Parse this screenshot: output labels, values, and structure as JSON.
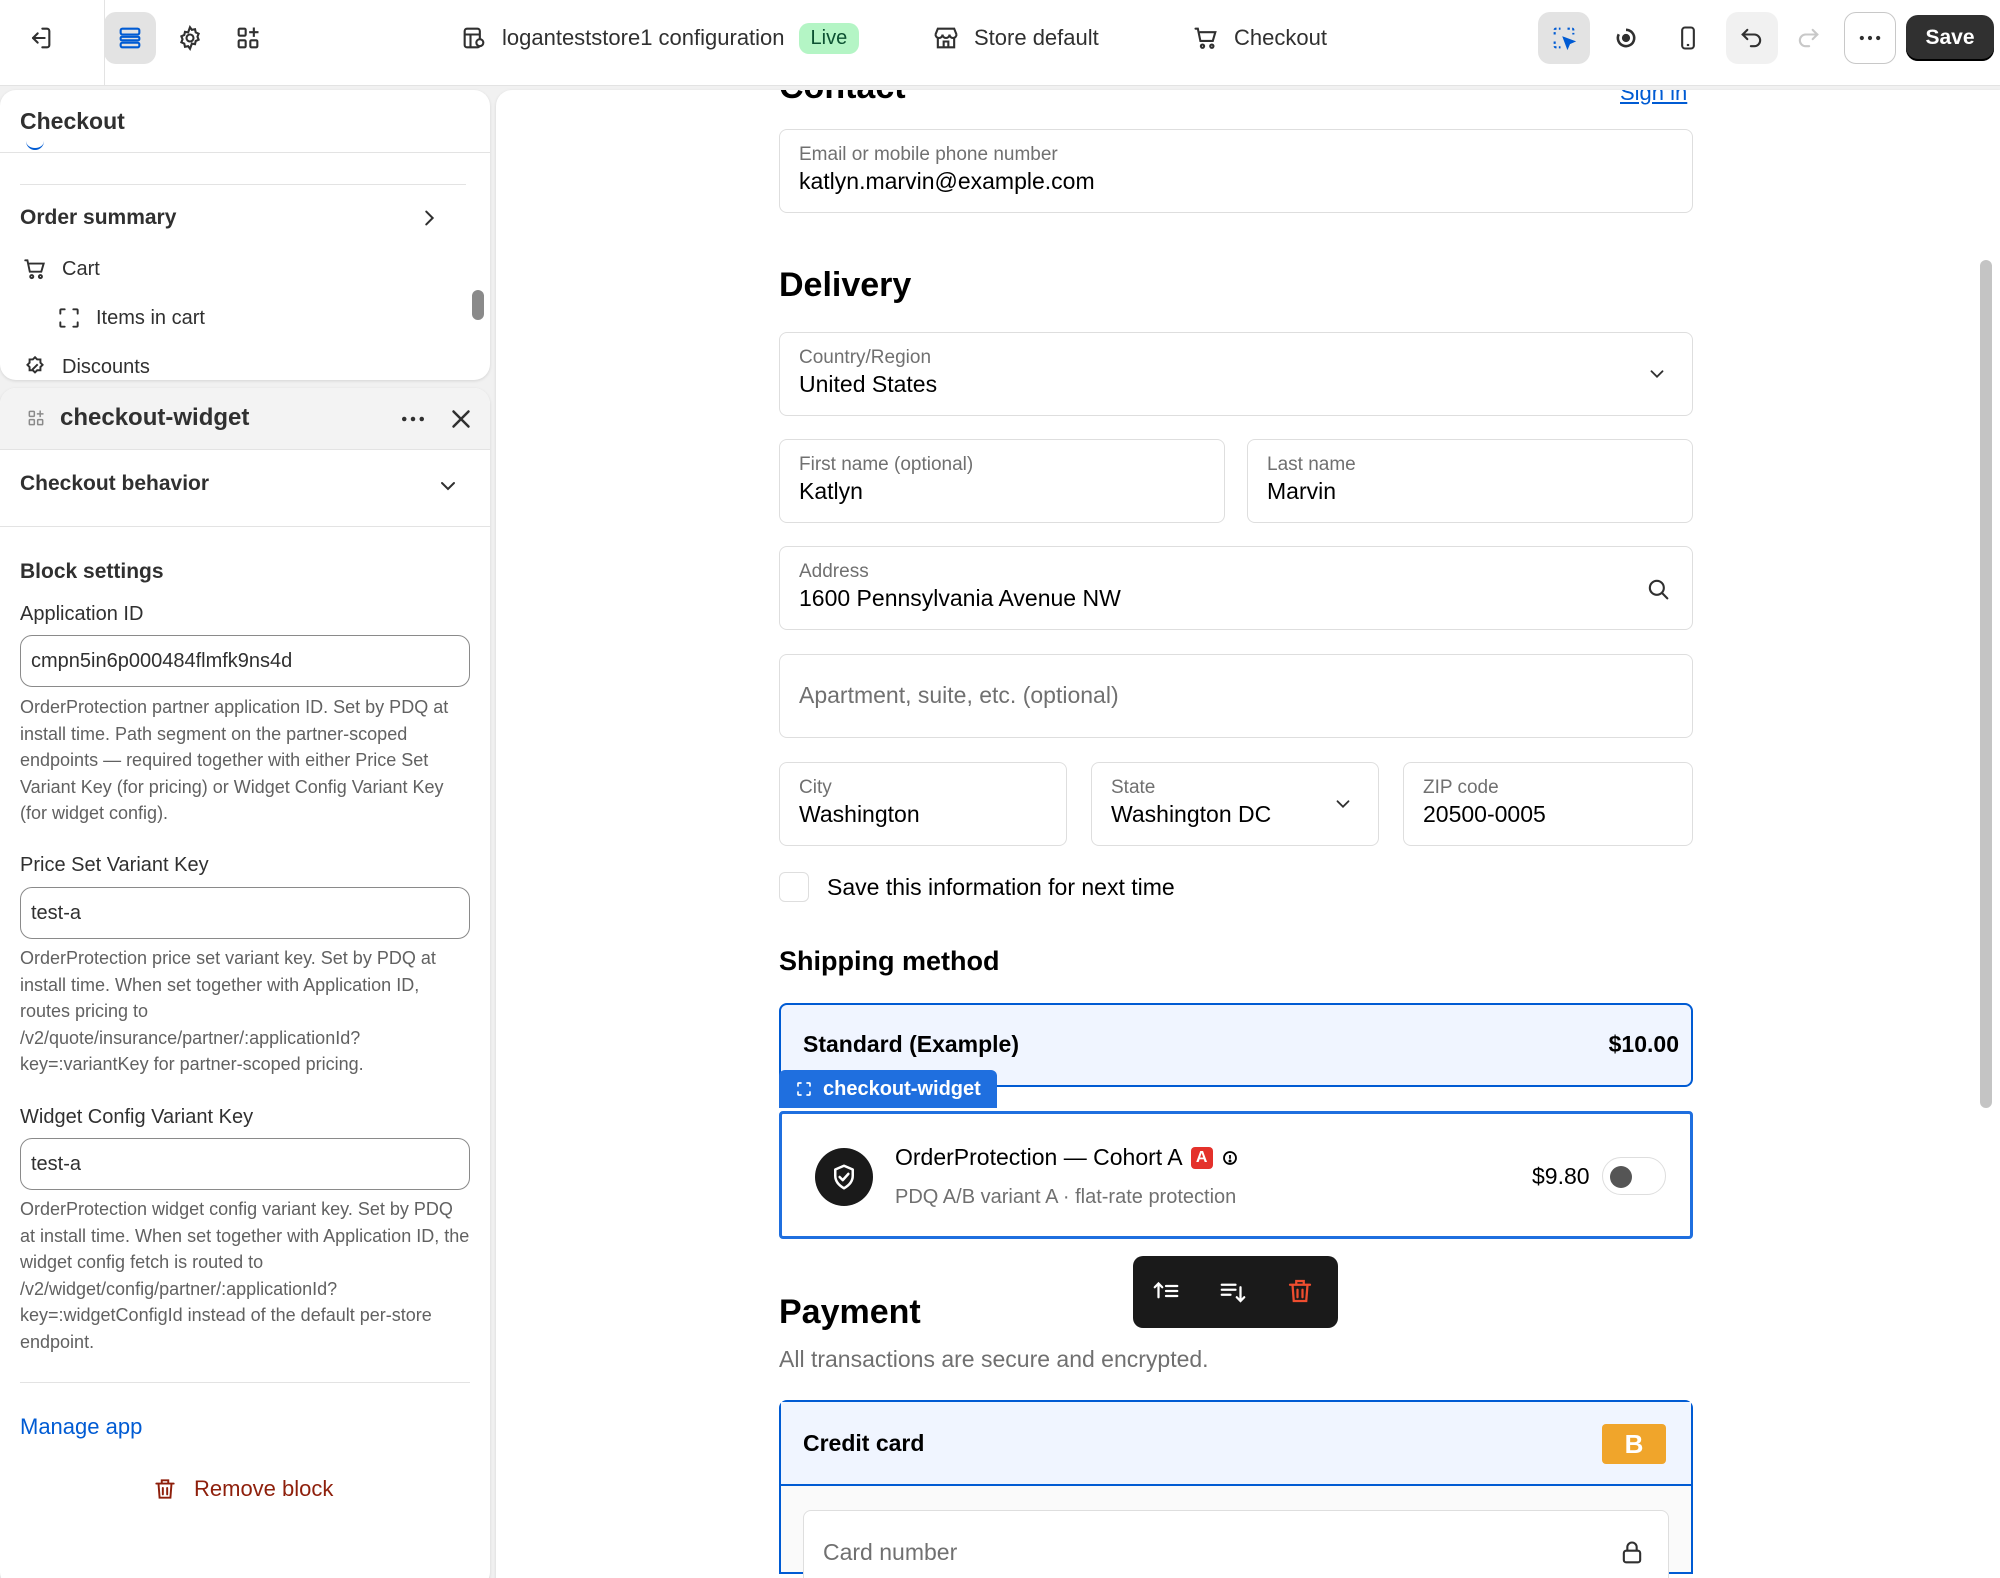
{
  "topbar": {
    "config_title": "loganteststore1 configuration",
    "live_badge": "Live",
    "store_label": "Store default",
    "page_label": "Checkout",
    "save_label": "Save"
  },
  "sidebar": {
    "panel_title": "Checkout",
    "order_summary": "Order summary",
    "cart": "Cart",
    "items_in_cart": "Items in cart",
    "discounts": "Discounts"
  },
  "block_panel": {
    "title": "checkout-widget",
    "checkout_behavior": "Checkout behavior",
    "block_settings": "Block settings",
    "application_id": {
      "label": "Application ID",
      "value": "cmpn5in6p000484flmfk9ns4d",
      "help": "OrderProtection partner application ID. Set by PDQ at install time. Path segment on the partner-scoped endpoints — required together with either Price Set Variant Key (for pricing) or Widget Config Variant Key (for widget config)."
    },
    "price_set_key": {
      "label": "Price Set Variant Key",
      "value": "test-a",
      "help": "OrderProtection price set variant key. Set by PDQ at install time. When set together with Application ID, routes pricing to /v2/quote/insurance/partner/:applicationId?key=:variantKey for partner-scoped pricing."
    },
    "widget_config_key": {
      "label": "Widget Config Variant Key",
      "value": "test-a",
      "help": "OrderProtection widget config variant key. Set by PDQ at install time. When set together with Application ID, the widget config fetch is routed to /v2/widget/config/partner/:applicationId?key=:widgetConfigId instead of the default per-store endpoint."
    },
    "manage_app": "Manage app",
    "remove_block": "Remove block"
  },
  "checkout": {
    "contact_heading": "Contact",
    "sign_in": "Sign in",
    "email": {
      "label": "Email or mobile phone number",
      "value": "katlyn.marvin@example.com"
    },
    "delivery_heading": "Delivery",
    "country": {
      "label": "Country/Region",
      "value": "United States"
    },
    "first_name": {
      "label": "First name (optional)",
      "value": "Katlyn"
    },
    "last_name": {
      "label": "Last name",
      "value": "Marvin"
    },
    "address": {
      "label": "Address",
      "value": "1600 Pennsylvania Avenue NW"
    },
    "apartment_placeholder": "Apartment, suite, etc. (optional)",
    "city": {
      "label": "City",
      "value": "Washington"
    },
    "state": {
      "label": "State",
      "value": "Washington DC"
    },
    "zip": {
      "label": "ZIP code",
      "value": "20500-0005"
    },
    "save_info": "Save this information for next time",
    "shipping_heading": "Shipping method",
    "shipping_option": {
      "name": "Standard (Example)",
      "price": "$10.00"
    },
    "widget_tag": "checkout-widget",
    "protection": {
      "title": "OrderProtection — Cohort A",
      "badge": "A",
      "subtitle": "PDQ A/B variant A · flat-rate protection",
      "price": "$9.80",
      "enabled": false
    },
    "payment_heading": "Payment",
    "payment_subtitle": "All transactions are secure and encrypted.",
    "credit_card": "Credit card",
    "card_badge": "B",
    "card_number_placeholder": "Card number"
  },
  "colors": {
    "accent": "#005bd3",
    "live_green": "#b4f5c5",
    "danger": "#8e1f0b",
    "card_badge": "#f0a52b"
  }
}
